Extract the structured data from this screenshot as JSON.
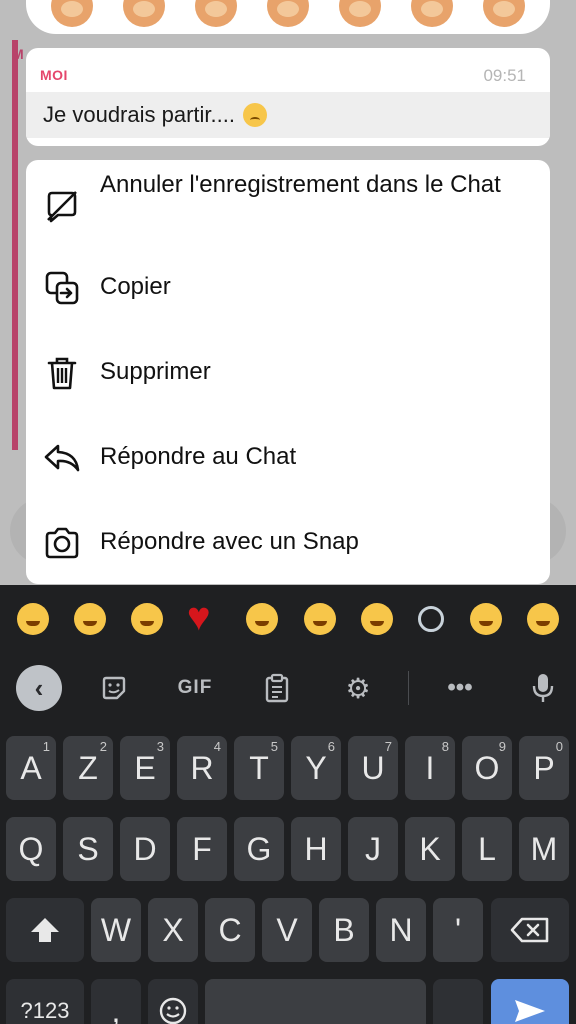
{
  "reactions": [
    "reaction-1",
    "reaction-2",
    "reaction-3",
    "reaction-4",
    "reaction-5",
    "reaction-6",
    "reaction-7"
  ],
  "message": {
    "sender": "MOI",
    "time": "09:51",
    "text": "Je voudrais partir...."
  },
  "menu": {
    "items": [
      {
        "label": "Annuler l'enregistrement dans le Chat",
        "icon": "unsave-icon"
      },
      {
        "label": "Copier",
        "icon": "copy-icon"
      },
      {
        "label": "Supprimer",
        "icon": "trash-icon"
      },
      {
        "label": "Répondre au Chat",
        "icon": "reply-icon"
      },
      {
        "label": "Répondre avec un Snap",
        "icon": "camera-icon"
      }
    ]
  },
  "keyboard": {
    "toolbar": {
      "gif_label": "GIF",
      "dots_label": "•••"
    },
    "row1": [
      {
        "key": "A",
        "hint": "1"
      },
      {
        "key": "Z",
        "hint": "2"
      },
      {
        "key": "E",
        "hint": "3"
      },
      {
        "key": "R",
        "hint": "4"
      },
      {
        "key": "T",
        "hint": "5"
      },
      {
        "key": "Y",
        "hint": "6"
      },
      {
        "key": "U",
        "hint": "7"
      },
      {
        "key": "I",
        "hint": "8"
      },
      {
        "key": "O",
        "hint": "9"
      },
      {
        "key": "P",
        "hint": "0"
      }
    ],
    "row2": [
      "Q",
      "S",
      "D",
      "F",
      "G",
      "H",
      "J",
      "K",
      "L",
      "M"
    ],
    "row3": [
      "W",
      "X",
      "C",
      "V",
      "B",
      "N",
      "'"
    ],
    "row4": {
      "symbols": "?123",
      "comma": ","
    }
  },
  "colors": {
    "sender_accent": "#e5466b",
    "keyboard_bg": "#1f2022",
    "key_bg": "#3c3e42",
    "enter_key": "#5e8fde"
  }
}
